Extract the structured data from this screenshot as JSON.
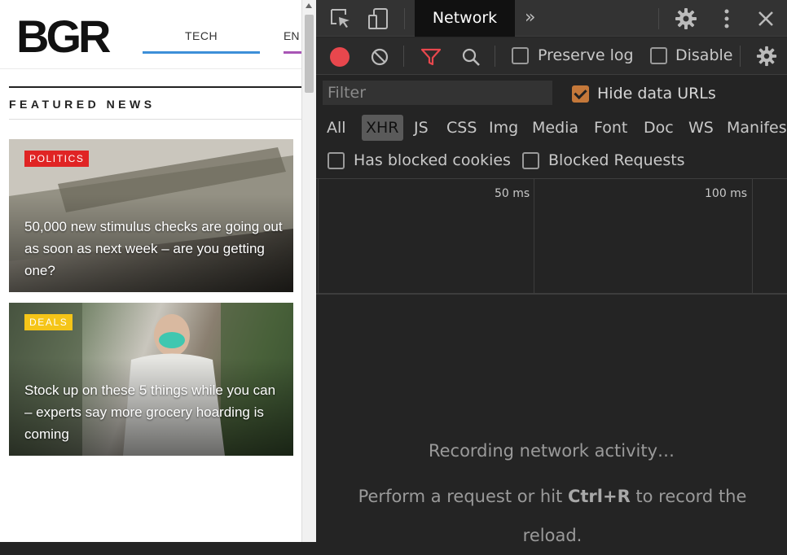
{
  "site": {
    "logo_text": "BGR",
    "nav": [
      {
        "label": "TECH"
      },
      {
        "label": "EN"
      }
    ],
    "section_title": "FEATURED NEWS",
    "cards": [
      {
        "badge": "POLITICS",
        "headline": "50,000 new stimulus checks are going out as soon as next week – are you getting one?"
      },
      {
        "badge": "DEALS",
        "headline": "Stock up on these 5 things while you can – experts say more grocery hoarding is coming"
      }
    ]
  },
  "devtools": {
    "tabs": {
      "active": "Network",
      "more_icon": "chevrons-right-icon"
    },
    "toolbar": {
      "preserve_log_label": "Preserve log",
      "disable_cache_label": "Disable"
    },
    "filter": {
      "placeholder": "Filter",
      "value": "",
      "hide_data_urls_label": "Hide data URLs",
      "hide_data_urls_checked": true
    },
    "types": [
      "All",
      "XHR",
      "JS",
      "CSS",
      "Img",
      "Media",
      "Font",
      "Doc",
      "WS",
      "Manifest"
    ],
    "active_type": "XHR",
    "blocked": {
      "cookies_label": "Has blocked cookies",
      "requests_label": "Blocked Requests"
    },
    "timeline": {
      "tick1": "50 ms",
      "tick2": "100 ms"
    },
    "empty": {
      "line1": "Recording network activity…",
      "hint_pre": "Perform a request or hit ",
      "hint_key": "Ctrl+R",
      "hint_post": " to record the reload."
    },
    "colors": {
      "record": "#e8474d",
      "filter_active": "#e8474d",
      "checkbox_checked": "#c4783a",
      "active_tab_bg": "#111111"
    }
  }
}
